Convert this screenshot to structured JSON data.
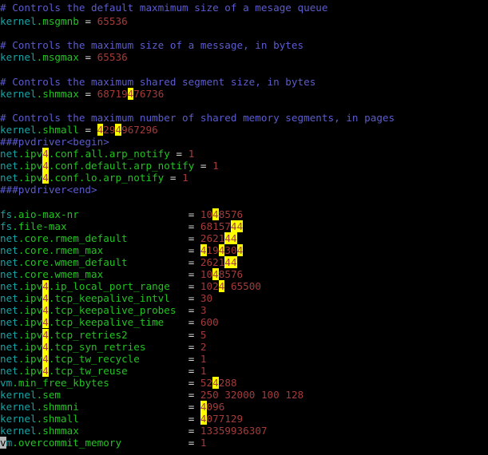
{
  "terminal": {
    "background": "#000000",
    "colors": {
      "comment": "#5c5ccd",
      "namespace": "#13a5a5",
      "key": "#22c322",
      "equals": "#d8d8d8",
      "value": "#a33b3b",
      "search_highlight_bg": "#ffff00",
      "cursor_bg": "#b8b8b8"
    },
    "search_term": "4",
    "cursor": {
      "line": 37,
      "column": 1,
      "char": "v"
    }
  },
  "lines": [
    {
      "id": 1,
      "type": "comment",
      "text": "# Controls the default maxmimum size of a mesage queue"
    },
    {
      "id": 2,
      "type": "assign",
      "ns": "kernel",
      "key": ".msgmnb",
      "eq": " = ",
      "value": "65536"
    },
    {
      "id": 3,
      "type": "blank",
      "text": ""
    },
    {
      "id": 4,
      "type": "comment",
      "text": "# Controls the maximum size of a message, in bytes"
    },
    {
      "id": 5,
      "type": "assign",
      "ns": "kernel",
      "key": ".msgmax",
      "eq": " = ",
      "value": "65536"
    },
    {
      "id": 6,
      "type": "blank",
      "text": ""
    },
    {
      "id": 7,
      "type": "comment",
      "text": "# Controls the maximum shared segment size, in bytes"
    },
    {
      "id": 8,
      "type": "assign",
      "ns": "kernel",
      "key": ".shmmax",
      "eq": " = ",
      "value": "68719476736"
    },
    {
      "id": 9,
      "type": "blank",
      "text": ""
    },
    {
      "id": 10,
      "type": "comment",
      "text": "# Controls the maximum number of shared memory segments, in pages"
    },
    {
      "id": 11,
      "type": "assign",
      "ns": "kernel",
      "key": ".shmall",
      "eq": " = ",
      "value": "4294967296"
    },
    {
      "id": 12,
      "type": "comment",
      "text": "###pvdriver<begin>"
    },
    {
      "id": 13,
      "type": "assign",
      "ns": "net",
      "key": ".ipv4.conf.all.arp_notify",
      "eq": " = ",
      "value": "1"
    },
    {
      "id": 14,
      "type": "assign",
      "ns": "net",
      "key": ".ipv4.conf.default.arp_notify",
      "eq": " = ",
      "value": "1"
    },
    {
      "id": 15,
      "type": "assign",
      "ns": "net",
      "key": ".ipv4.conf.lo.arp_notify",
      "eq": " = ",
      "value": "1"
    },
    {
      "id": 16,
      "type": "comment",
      "text": "###pvdriver<end>"
    },
    {
      "id": 17,
      "type": "blank",
      "text": ""
    },
    {
      "id": 18,
      "type": "table",
      "ns": "fs",
      "key": ".aio-max-nr",
      "eq": "=",
      "value": "1048576"
    },
    {
      "id": 19,
      "type": "table",
      "ns": "fs",
      "key": ".file-max",
      "eq": "=",
      "value": "6815744"
    },
    {
      "id": 20,
      "type": "table",
      "ns": "net",
      "key": ".core.rmem_default",
      "eq": "=",
      "value": "262144"
    },
    {
      "id": 21,
      "type": "table",
      "ns": "net",
      "key": ".core.rmem_max",
      "eq": "=",
      "value": "4194304"
    },
    {
      "id": 22,
      "type": "table",
      "ns": "net",
      "key": ".core.wmem_default",
      "eq": "=",
      "value": "262144"
    },
    {
      "id": 23,
      "type": "table",
      "ns": "net",
      "key": ".core.wmem_max",
      "eq": "=",
      "value": "1048576"
    },
    {
      "id": 24,
      "type": "table",
      "ns": "net",
      "key": ".ipv4.ip_local_port_range",
      "eq": "=",
      "value": "1024 65500"
    },
    {
      "id": 25,
      "type": "table",
      "ns": "net",
      "key": ".ipv4.tcp_keepalive_intvl",
      "eq": "=",
      "value": "30"
    },
    {
      "id": 26,
      "type": "table",
      "ns": "net",
      "key": ".ipv4.tcp_keepalive_probes",
      "eq": "=",
      "value": "3"
    },
    {
      "id": 27,
      "type": "table",
      "ns": "net",
      "key": ".ipv4.tcp_keepalive_time",
      "eq": "=",
      "value": "600"
    },
    {
      "id": 28,
      "type": "table",
      "ns": "net",
      "key": ".ipv4.tcp_retries2",
      "eq": "=",
      "value": "5"
    },
    {
      "id": 29,
      "type": "table",
      "ns": "net",
      "key": ".ipv4.tcp_syn_retries",
      "eq": "=",
      "value": "2"
    },
    {
      "id": 30,
      "type": "table",
      "ns": "net",
      "key": ".ipv4.tcp_tw_recycle",
      "eq": "=",
      "value": "1"
    },
    {
      "id": 31,
      "type": "table",
      "ns": "net",
      "key": ".ipv4.tcp_tw_reuse",
      "eq": "=",
      "value": "1"
    },
    {
      "id": 32,
      "type": "table",
      "ns": "vm",
      "key": ".min_free_kbytes",
      "eq": "=",
      "value": "524288"
    },
    {
      "id": 33,
      "type": "table",
      "ns": "kernel",
      "key": ".sem",
      "eq": "=",
      "value": "250 32000 100 128"
    },
    {
      "id": 34,
      "type": "table",
      "ns": "kernel",
      "key": ".shmmni",
      "eq": "=",
      "value": "4096"
    },
    {
      "id": 35,
      "type": "table",
      "ns": "kernel",
      "key": ".shmall",
      "eq": "=",
      "value": "4077129"
    },
    {
      "id": 36,
      "type": "table",
      "ns": "kernel",
      "key": ".shmmax",
      "eq": "=",
      "value": "13359936307"
    },
    {
      "id": 37,
      "type": "table",
      "ns": "vm",
      "key": ".overcommit_memory",
      "eq": "=",
      "value": "1",
      "cursor": true
    }
  ]
}
